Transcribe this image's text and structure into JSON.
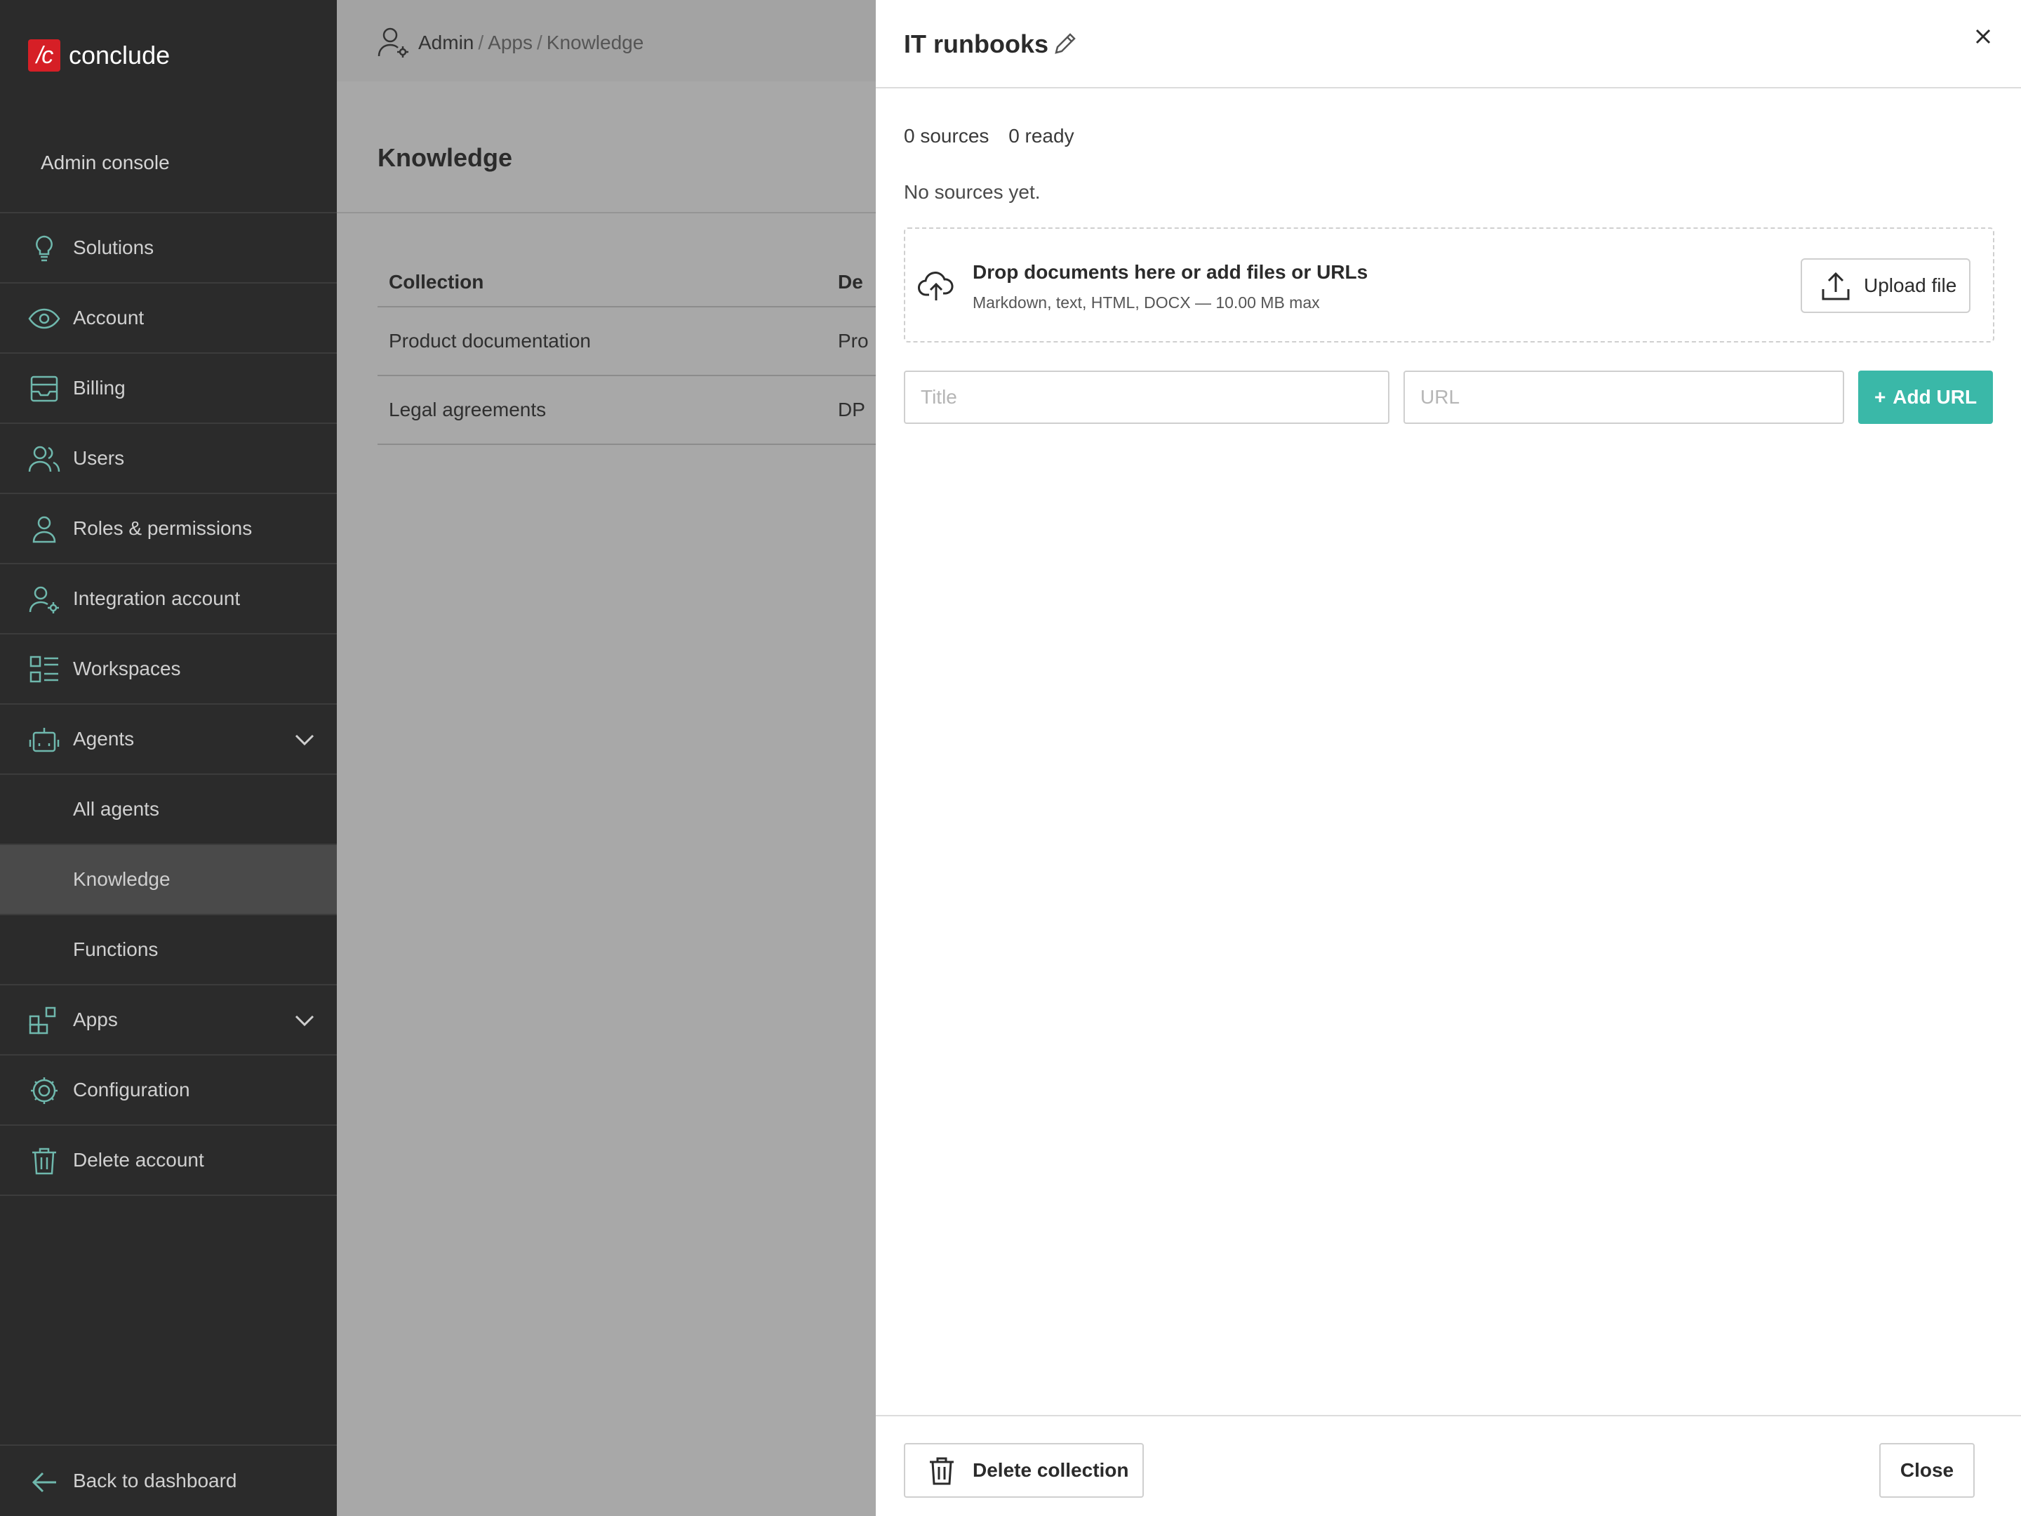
{
  "app": {
    "logo_mark": "/c",
    "logo_text": "conclude"
  },
  "sidebar": {
    "section_label": "Admin console",
    "items": [
      {
        "label": "Solutions",
        "icon": "lightbulb-icon"
      },
      {
        "label": "Account",
        "icon": "eye-icon"
      },
      {
        "label": "Billing",
        "icon": "inbox-icon"
      },
      {
        "label": "Users",
        "icon": "users-icon"
      },
      {
        "label": "Roles & permissions",
        "icon": "user-icon"
      },
      {
        "label": "Integration account",
        "icon": "user-gear-icon"
      },
      {
        "label": "Workspaces",
        "icon": "list-grid-icon"
      },
      {
        "label": "Agents",
        "icon": "robot-icon",
        "expanded": true
      },
      {
        "label": "All agents"
      },
      {
        "label": "Knowledge",
        "active": true
      },
      {
        "label": "Functions"
      },
      {
        "label": "Apps",
        "icon": "apps-icon",
        "expanded": true
      },
      {
        "label": "Configuration",
        "icon": "gear-icon"
      },
      {
        "label": "Delete account",
        "icon": "trash-icon"
      }
    ],
    "back_label": "Back to dashboard"
  },
  "breadcrumb": {
    "admin": "Admin",
    "sep1": "/",
    "apps": "Apps",
    "sep2": "/",
    "current": "Knowledge"
  },
  "page": {
    "title": "Knowledge",
    "table": {
      "headers": [
        "Collection",
        "De"
      ],
      "rows": [
        [
          "Product documentation",
          "Pro"
        ],
        [
          "Legal agreements",
          "DP"
        ]
      ]
    }
  },
  "drawer": {
    "title": "IT runbooks",
    "sources_count": "0 sources",
    "ready_count": "0 ready",
    "empty_text": "No sources yet.",
    "dropzone": {
      "title": "Drop documents here or add files or URLs",
      "subtitle": "Markdown, text, HTML, DOCX — 10.00 MB max",
      "upload_label": "Upload file"
    },
    "title_placeholder": "Title",
    "url_placeholder": "URL",
    "add_url_plus": "+",
    "add_url_label": "Add URL",
    "delete_label": "Delete collection",
    "close_label": "Close"
  },
  "colors": {
    "sidebar_bg": "#2b2b2b",
    "icon_accent": "#6fb8ad",
    "primary_button": "#3ab8a8",
    "logo_red": "#d61f26",
    "overlay": "#a8a8a8"
  }
}
